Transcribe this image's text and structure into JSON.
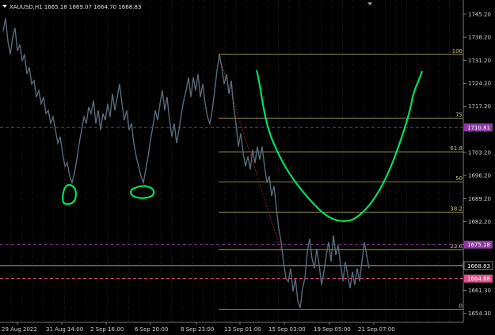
{
  "symbol_info": "XAUUSD,H1  1665.18 1669.07 1664.70 1668.83",
  "colors": {
    "background": "#000000",
    "grid": "#3a3a3a",
    "candles": "#5a6a7a",
    "fib": "#c8c070",
    "ask_line": "#8a3aa0",
    "bid_line": "#e0508a",
    "current_line": "#c8c8c8",
    "annotation": "#00e060",
    "trend_line": "#b03020"
  },
  "price_axis": [
    "1745.20",
    "1738.20",
    "1731.20",
    "1724.20",
    "1717.20",
    "1710.20",
    "1703.20",
    "1696.20",
    "1689.20",
    "1682.20",
    "1675.20",
    "1668.20",
    "1661.30",
    "1654.30"
  ],
  "time_axis": [
    "29 Aug 2022",
    "31 Aug 14:00",
    "2 Sep 16:00",
    "6 Sep 20:00",
    "8 Sep 23:00",
    "13 Sep 01:00",
    "15 Sep 03:00",
    "19 Sep 05:00",
    "21 Sep 07:00"
  ],
  "fib_levels": [
    {
      "label": "100",
      "price": 1733.0
    },
    {
      "label": "75",
      "price": 1713.6
    },
    {
      "label": "61.8",
      "price": 1703.4
    },
    {
      "label": "50",
      "price": 1694.3
    },
    {
      "label": "38.2",
      "price": 1685.1
    },
    {
      "label": "23.6",
      "price": 1673.7
    },
    {
      "label": "0",
      "price": 1655.6
    }
  ],
  "price_badges": [
    {
      "label": "1710.81",
      "kind": "ask",
      "price": 1710.8
    },
    {
      "label": "1675.18",
      "kind": "ask",
      "price": 1675.2
    },
    {
      "label": "1668.83",
      "kind": "current",
      "price": 1668.8
    },
    {
      "label": "1664.88",
      "kind": "bid",
      "price": 1664.9
    }
  ],
  "price_range": [
    1651.6,
    1749.5
  ],
  "series_points": [
    [
      0,
      1740
    ],
    [
      3,
      1744
    ],
    [
      6,
      1737
    ],
    [
      9,
      1733
    ],
    [
      12,
      1738
    ],
    [
      15,
      1741
    ],
    [
      18,
      1734
    ],
    [
      21,
      1736
    ],
    [
      24,
      1731
    ],
    [
      27,
      1733
    ],
    [
      30,
      1727
    ],
    [
      33,
      1729
    ],
    [
      36,
      1724
    ],
    [
      39,
      1725
    ],
    [
      42,
      1720
    ],
    [
      45,
      1722
    ],
    [
      48,
      1718
    ],
    [
      51,
      1720
    ],
    [
      54,
      1715
    ],
    [
      57,
      1716
    ],
    [
      60,
      1712
    ],
    [
      63,
      1714
    ],
    [
      66,
      1710
    ],
    [
      69,
      1706
    ],
    [
      72,
      1708
    ],
    [
      75,
      1703
    ],
    [
      78,
      1699
    ],
    [
      81,
      1700
    ],
    [
      84,
      1696
    ],
    [
      87,
      1694
    ],
    [
      90,
      1697
    ],
    [
      93,
      1701
    ],
    [
      96,
      1706
    ],
    [
      99,
      1710
    ],
    [
      102,
      1714
    ],
    [
      105,
      1712
    ],
    [
      108,
      1717
    ],
    [
      111,
      1715
    ],
    [
      114,
      1719
    ],
    [
      117,
      1712
    ],
    [
      120,
      1716
    ],
    [
      123,
      1710
    ],
    [
      126,
      1715
    ],
    [
      129,
      1713
    ],
    [
      132,
      1718
    ],
    [
      135,
      1714
    ],
    [
      138,
      1721
    ],
    [
      141,
      1716
    ],
    [
      144,
      1720
    ],
    [
      147,
      1724
    ],
    [
      150,
      1718
    ],
    [
      153,
      1713
    ],
    [
      156,
      1716
    ],
    [
      159,
      1710
    ],
    [
      162,
      1712
    ],
    [
      165,
      1706
    ],
    [
      168,
      1702
    ],
    [
      171,
      1699
    ],
    [
      174,
      1696
    ],
    [
      177,
      1694
    ],
    [
      180,
      1698
    ],
    [
      183,
      1702
    ],
    [
      186,
      1707
    ],
    [
      189,
      1711
    ],
    [
      192,
      1716
    ],
    [
      195,
      1713
    ],
    [
      198,
      1718
    ],
    [
      201,
      1722
    ],
    [
      204,
      1716
    ],
    [
      207,
      1720
    ],
    [
      210,
      1713
    ],
    [
      213,
      1708
    ],
    [
      216,
      1712
    ],
    [
      219,
      1706
    ],
    [
      222,
      1710
    ],
    [
      225,
      1715
    ],
    [
      228,
      1719
    ],
    [
      231,
      1722
    ],
    [
      234,
      1726
    ],
    [
      237,
      1720
    ],
    [
      240,
      1726
    ],
    [
      243,
      1722
    ],
    [
      246,
      1727
    ],
    [
      249,
      1720
    ],
    [
      252,
      1724
    ],
    [
      255,
      1718
    ],
    [
      258,
      1714
    ],
    [
      261,
      1712
    ],
    [
      264,
      1716
    ],
    [
      267,
      1722
    ],
    [
      270,
      1728
    ],
    [
      273,
      1733
    ],
    [
      276,
      1729
    ],
    [
      279,
      1724
    ],
    [
      282,
      1727
    ],
    [
      285,
      1721
    ],
    [
      288,
      1725
    ],
    [
      291,
      1717
    ],
    [
      294,
      1712
    ],
    [
      297,
      1705
    ],
    [
      300,
      1709
    ],
    [
      303,
      1703
    ],
    [
      306,
      1699
    ],
    [
      309,
      1702
    ],
    [
      312,
      1698
    ],
    [
      315,
      1704
    ],
    [
      318,
      1700
    ],
    [
      321,
      1705
    ],
    [
      324,
      1701
    ],
    [
      327,
      1705
    ],
    [
      330,
      1699
    ],
    [
      333,
      1694
    ],
    [
      336,
      1696
    ],
    [
      339,
      1690
    ],
    [
      342,
      1693
    ],
    [
      345,
      1686
    ],
    [
      348,
      1680
    ],
    [
      351,
      1676
    ],
    [
      354,
      1670
    ],
    [
      357,
      1665
    ],
    [
      360,
      1664
    ],
    [
      363,
      1668
    ],
    [
      366,
      1661
    ],
    [
      369,
      1665
    ],
    [
      372,
      1658
    ],
    [
      375,
      1656
    ],
    [
      378,
      1662
    ],
    [
      381,
      1665
    ],
    [
      384,
      1673
    ],
    [
      387,
      1677
    ],
    [
      390,
      1671
    ],
    [
      393,
      1668
    ],
    [
      396,
      1674
    ],
    [
      399,
      1669
    ],
    [
      402,
      1663
    ],
    [
      405,
      1667
    ],
    [
      408,
      1672
    ],
    [
      411,
      1676
    ],
    [
      414,
      1670
    ],
    [
      417,
      1678
    ],
    [
      420,
      1672
    ],
    [
      423,
      1675
    ],
    [
      426,
      1669
    ],
    [
      429,
      1664
    ],
    [
      432,
      1670
    ],
    [
      435,
      1666
    ],
    [
      438,
      1662
    ],
    [
      441,
      1667
    ],
    [
      444,
      1663
    ],
    [
      447,
      1668
    ],
    [
      450,
      1664
    ],
    [
      453,
      1670
    ],
    [
      456,
      1676
    ],
    [
      459,
      1672
    ],
    [
      462,
      1668
    ]
  ]
}
